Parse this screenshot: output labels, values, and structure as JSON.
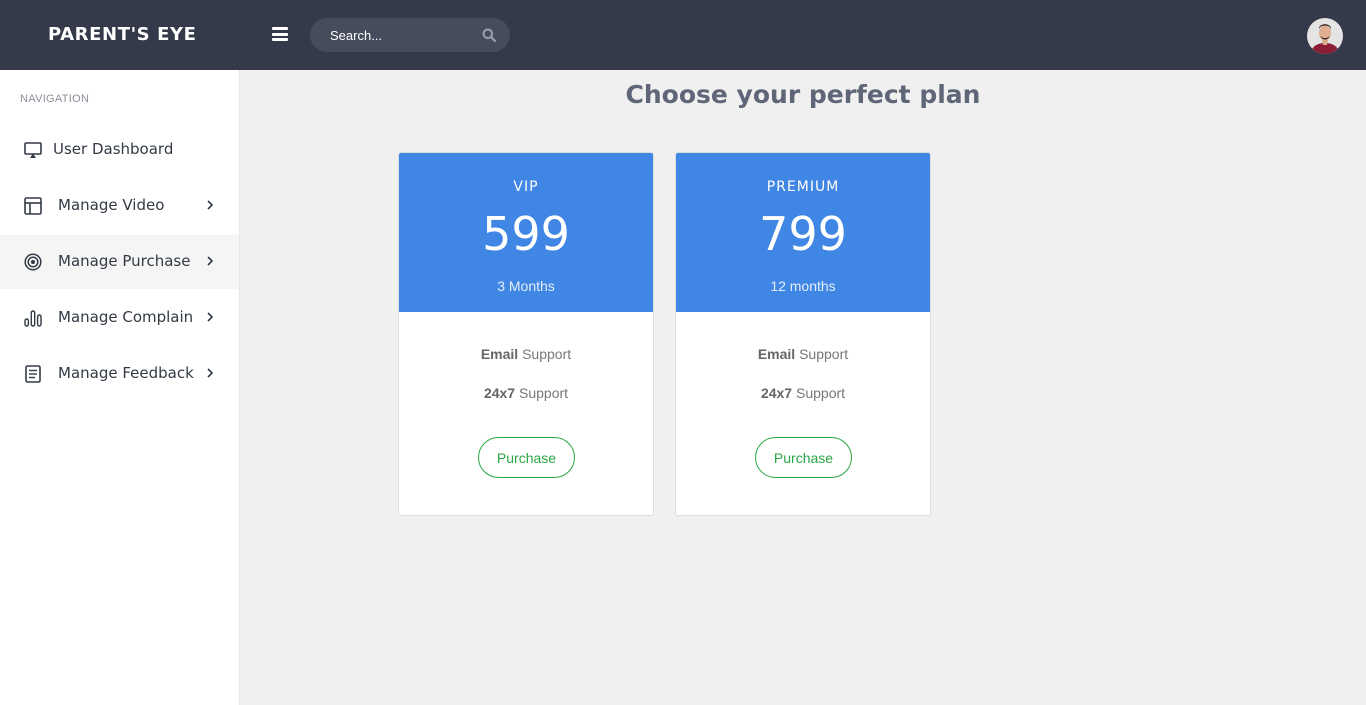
{
  "header": {
    "brand": "PARENT'S EYE",
    "search_placeholder": "Search...",
    "menu_icon": "hamburger-icon",
    "search_icon": "search-icon",
    "avatar": "user-avatar"
  },
  "sidebar": {
    "title": "NAVIGATION",
    "items": [
      {
        "label": "User Dashboard",
        "icon": "monitor-icon",
        "has_submenu": false,
        "active": false
      },
      {
        "label": "Manage Video",
        "icon": "layout-icon",
        "has_submenu": true,
        "active": false
      },
      {
        "label": "Manage Purchase",
        "icon": "target-icon",
        "has_submenu": true,
        "active": true
      },
      {
        "label": "Manage Complain",
        "icon": "bar-chart-icon",
        "has_submenu": true,
        "active": false
      },
      {
        "label": "Manage Feedback",
        "icon": "document-icon",
        "has_submenu": true,
        "active": false
      }
    ]
  },
  "main": {
    "title": "Choose your perfect plan",
    "plans": [
      {
        "name": "VIP",
        "price": "599",
        "duration": "3 Months",
        "features": [
          {
            "bold": "Email",
            "rest": " Support"
          },
          {
            "bold": "24x7",
            "rest": " Support"
          }
        ],
        "button": "Purchase"
      },
      {
        "name": "PREMIUM",
        "price": "799",
        "duration": "12 months",
        "features": [
          {
            "bold": "Email",
            "rest": " Support"
          },
          {
            "bold": "24x7",
            "rest": " Support"
          }
        ],
        "button": "Purchase"
      }
    ]
  },
  "colors": {
    "topbar": "#343a49",
    "accent": "#4086e4",
    "purchase": "#28a745",
    "background": "#f0f0f0"
  }
}
